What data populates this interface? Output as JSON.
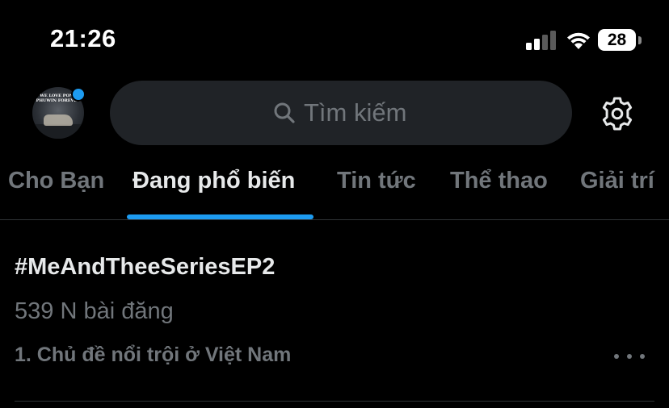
{
  "status_bar": {
    "time": "21:26",
    "battery_level": "28",
    "icons": [
      "cellular-signal-icon",
      "wifi-icon",
      "battery-icon"
    ]
  },
  "header": {
    "avatar": {
      "text": "WE LOVE POND PHUWIN FOREVER",
      "has_notification": true
    },
    "search": {
      "placeholder": "Tìm kiếm",
      "icon": "search-icon"
    },
    "settings_icon": "gear-icon"
  },
  "tabs": [
    {
      "label": "Cho Bạn",
      "active": false
    },
    {
      "label": "Đang phổ biến",
      "active": true
    },
    {
      "label": "Tin tức",
      "active": false
    },
    {
      "label": "Thể thao",
      "active": false
    },
    {
      "label": "Giải trí",
      "active": false
    }
  ],
  "trends": [
    {
      "title": "#MeAndTheeSeriesEP2",
      "post_count": "539 N bài đăng",
      "context": "1. Chủ đề nổi trội ở Việt Nam",
      "more_icon": "more-dots-icon"
    }
  ],
  "colors": {
    "background": "#000000",
    "accent": "#1d9bf0",
    "primary_text": "#e7e9ea",
    "secondary_text": "#71767b",
    "search_background": "#202327",
    "divider": "#2f3336"
  }
}
